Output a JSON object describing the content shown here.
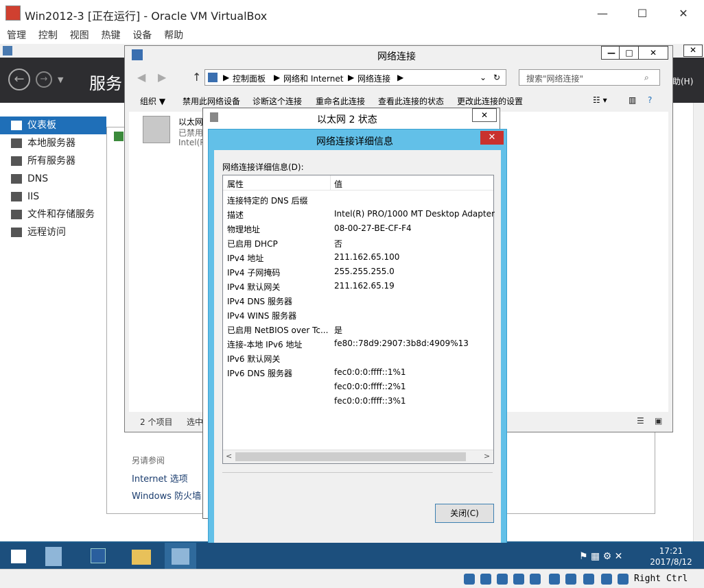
{
  "window": {
    "title": "Win2012-3 [正在运行] - Oracle VM VirtualBox",
    "minimize": "—",
    "maximize": "☐",
    "close": "✕"
  },
  "vbox_menu": [
    "管理",
    "控制",
    "视图",
    "热键",
    "设备",
    "帮助"
  ],
  "server_manager": {
    "title": "服务",
    "help_fragment": "助(H)",
    "nav": [
      {
        "label": "仪表板",
        "active": true
      },
      {
        "label": "本地服务器"
      },
      {
        "label": "所有服务器"
      },
      {
        "label": "DNS"
      },
      {
        "label": "IIS"
      },
      {
        "label": "文件和存储服务"
      },
      {
        "label": "远程访问"
      }
    ]
  },
  "control_panel_page": {
    "see_also": "另请参阅",
    "links": [
      "Internet 选项",
      "Windows 防火墙"
    ]
  },
  "network_connections": {
    "title": "网络连接",
    "breadcrumb": [
      "控制面板",
      "网络和 Internet",
      "网络连接"
    ],
    "search_placeholder": "搜索\"网络连接\"",
    "commands": [
      "组织 ▼",
      "禁用此网络设备",
      "诊断这个连接",
      "重命名此连接",
      "查看此连接的状态",
      "更改此连接的设置"
    ],
    "item": {
      "name": "以太网",
      "status": "已禁用",
      "device": "Intel(R"
    },
    "status_count": "2 个项目",
    "status_selected": "选中"
  },
  "eth_status": {
    "title": "以太网 2 状态",
    "close": "✕"
  },
  "details": {
    "title": "网络连接详细信息",
    "close": "✕",
    "label": "网络连接详细信息(D):",
    "col_property": "属性",
    "col_value": "值",
    "rows": [
      {
        "p": "连接特定的 DNS 后缀",
        "v": ""
      },
      {
        "p": "描述",
        "v": "Intel(R) PRO/1000 MT Desktop Adapter"
      },
      {
        "p": "物理地址",
        "v": "08-00-27-BE-CF-F4"
      },
      {
        "p": "已启用 DHCP",
        "v": "否"
      },
      {
        "p": "IPv4 地址",
        "v": "211.162.65.100"
      },
      {
        "p": "IPv4 子网掩码",
        "v": "255.255.255.0"
      },
      {
        "p": "IPv4 默认网关",
        "v": "211.162.65.19"
      },
      {
        "p": "IPv4 DNS 服务器",
        "v": ""
      },
      {
        "p": "IPv4 WINS 服务器",
        "v": ""
      },
      {
        "p": "已启用 NetBIOS over Tc...",
        "v": "是"
      },
      {
        "p": "连接-本地 IPv6 地址",
        "v": "fe80::78d9:2907:3b8d:4909%13"
      },
      {
        "p": "IPv6 默认网关",
        "v": ""
      },
      {
        "p": "IPv6 DNS 服务器",
        "v": "fec0:0:0:ffff::1%1"
      },
      {
        "p": "",
        "v": "fec0:0:0:ffff::2%1"
      },
      {
        "p": "",
        "v": "fec0:0:0:ffff::3%1"
      }
    ],
    "close_button": "关闭(C)"
  },
  "taskbar": {
    "time": "17:21",
    "date": "2017/8/12"
  },
  "vbox_status": {
    "hostkey": "Right Ctrl"
  },
  "colors": {
    "accent": "#1f6fb8",
    "dialog_frame": "#62c0e8",
    "close_red": "#c9322e",
    "taskbar": "#1c4f7d"
  }
}
